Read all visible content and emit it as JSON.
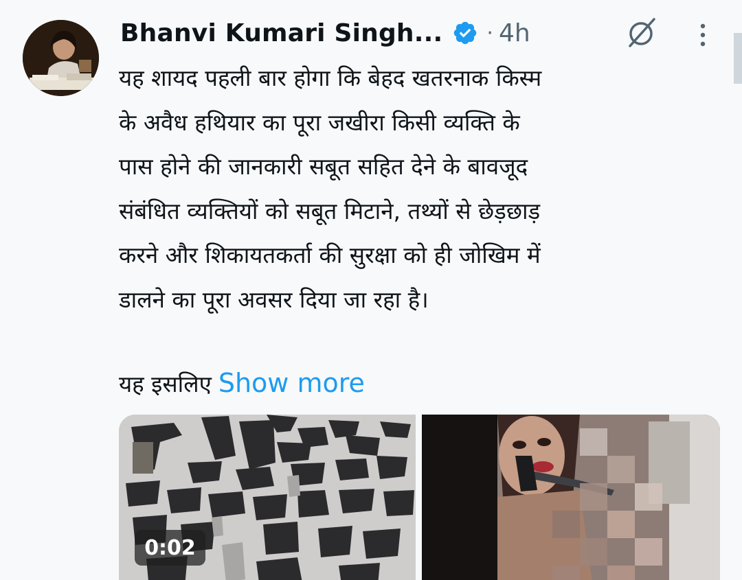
{
  "author": {
    "display_name": "Bhanvi Kumari Singh...",
    "verified": true,
    "separator": "·",
    "timestamp": "4h"
  },
  "tweet": {
    "lines": [
      "यह शायद पहली बार होगा कि बेहद खतरनाक किस्म",
      "के अवैध हथियार का पूरा जखीरा किसी व्यक्ति के",
      "पास होने की जानकारी सबूत सहित देने के बावजूद",
      "संबंधित व्यक्तियों को सबूत मिटाने, तथ्यों से छेड़छाड़",
      "करने और शिकायतकर्ता की सुरक्षा को ही जोखिम में",
      "डालने का पूरा अवसर दिया जा रहा है।"
    ],
    "continuation": "यह इसलिए",
    "show_more_label": "Show more"
  },
  "media": {
    "video": {
      "duration": "0:02",
      "icon": "video-thumbnail"
    },
    "photo": {
      "icon": "photo-thumbnail"
    }
  },
  "icons": {
    "verified": "verified-badge-icon",
    "grok": "grok-icon",
    "more": "more-vertical-icon"
  },
  "colors": {
    "background": "#f7f9fa",
    "text": "#0f1419",
    "secondary": "#536471",
    "accent": "#1d9bf0"
  }
}
